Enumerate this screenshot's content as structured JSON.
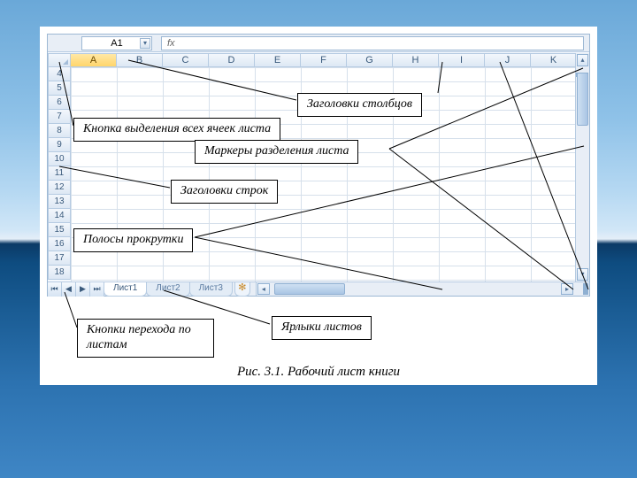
{
  "namebox": {
    "value": "A1",
    "fx": "fx"
  },
  "columns": [
    "A",
    "B",
    "C",
    "D",
    "E",
    "F",
    "G",
    "H",
    "I",
    "J",
    "K"
  ],
  "rows": [
    "4",
    "5",
    "6",
    "7",
    "8",
    "9",
    "10",
    "11",
    "12",
    "13",
    "14",
    "15",
    "16",
    "17",
    "18"
  ],
  "tabs": {
    "active": "Лист1",
    "others": [
      "Лист2",
      "Лист3"
    ],
    "insert_glyph": "✻"
  },
  "nav_glyphs": [
    "⏮",
    "◀",
    "▶",
    "⏭"
  ],
  "callouts": {
    "col_headers": "Заголовки  столбцов",
    "select_all": "Кнопка выделения всех ячеек листа",
    "split": "Маркеры разделения листа",
    "row_headers": "Заголовки  строк",
    "scrollbars": "Полосы прокрутки",
    "sheet_tabs": "Ярлыки листов",
    "nav_buttons": "Кнопки перехода по листам"
  },
  "caption": "Рис. 3.1. Рабочий лист книги"
}
